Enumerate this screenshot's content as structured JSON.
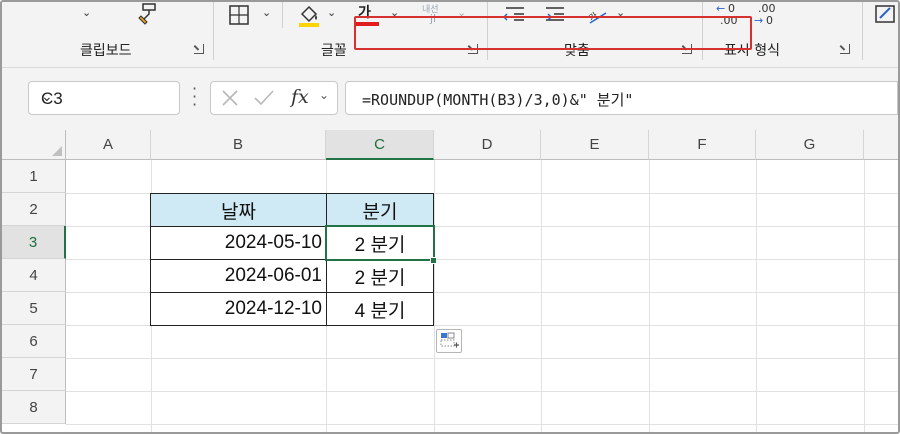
{
  "ribbon": {
    "groups": [
      {
        "label": "클립보드"
      },
      {
        "label": "글꼴"
      },
      {
        "label": "맞춤"
      },
      {
        "label": "표시 형식"
      }
    ],
    "font_color_glyph": "가",
    "wrap_glyph": "내선",
    "number_format_glyphs": {
      "increase": ".00",
      "decrease": ".00"
    },
    "colors": {
      "font_color": "#e01c1c",
      "fill_color": "#ffd400",
      "accent": "#217346"
    }
  },
  "formula_bar": {
    "name_box": "C3",
    "formula": "=ROUNDUP(MONTH(B3)/3,0)&\" 분기\"",
    "highlight_color": "#d63030",
    "fx_label": "fx"
  },
  "sheet": {
    "columns": [
      "A",
      "B",
      "C",
      "D",
      "E",
      "F",
      "G"
    ],
    "rows": [
      "1",
      "2",
      "3",
      "4",
      "5",
      "6",
      "7",
      "8"
    ],
    "selected_column": "C",
    "selected_row": "3",
    "table": {
      "headers": [
        "날짜",
        "분기"
      ],
      "rows": [
        [
          "2024-05-10",
          "2 분기"
        ],
        [
          "2024-06-01",
          "2 분기"
        ],
        [
          "2024-12-10",
          "4 분기"
        ]
      ],
      "header_fill": "#cfe9f5"
    }
  }
}
